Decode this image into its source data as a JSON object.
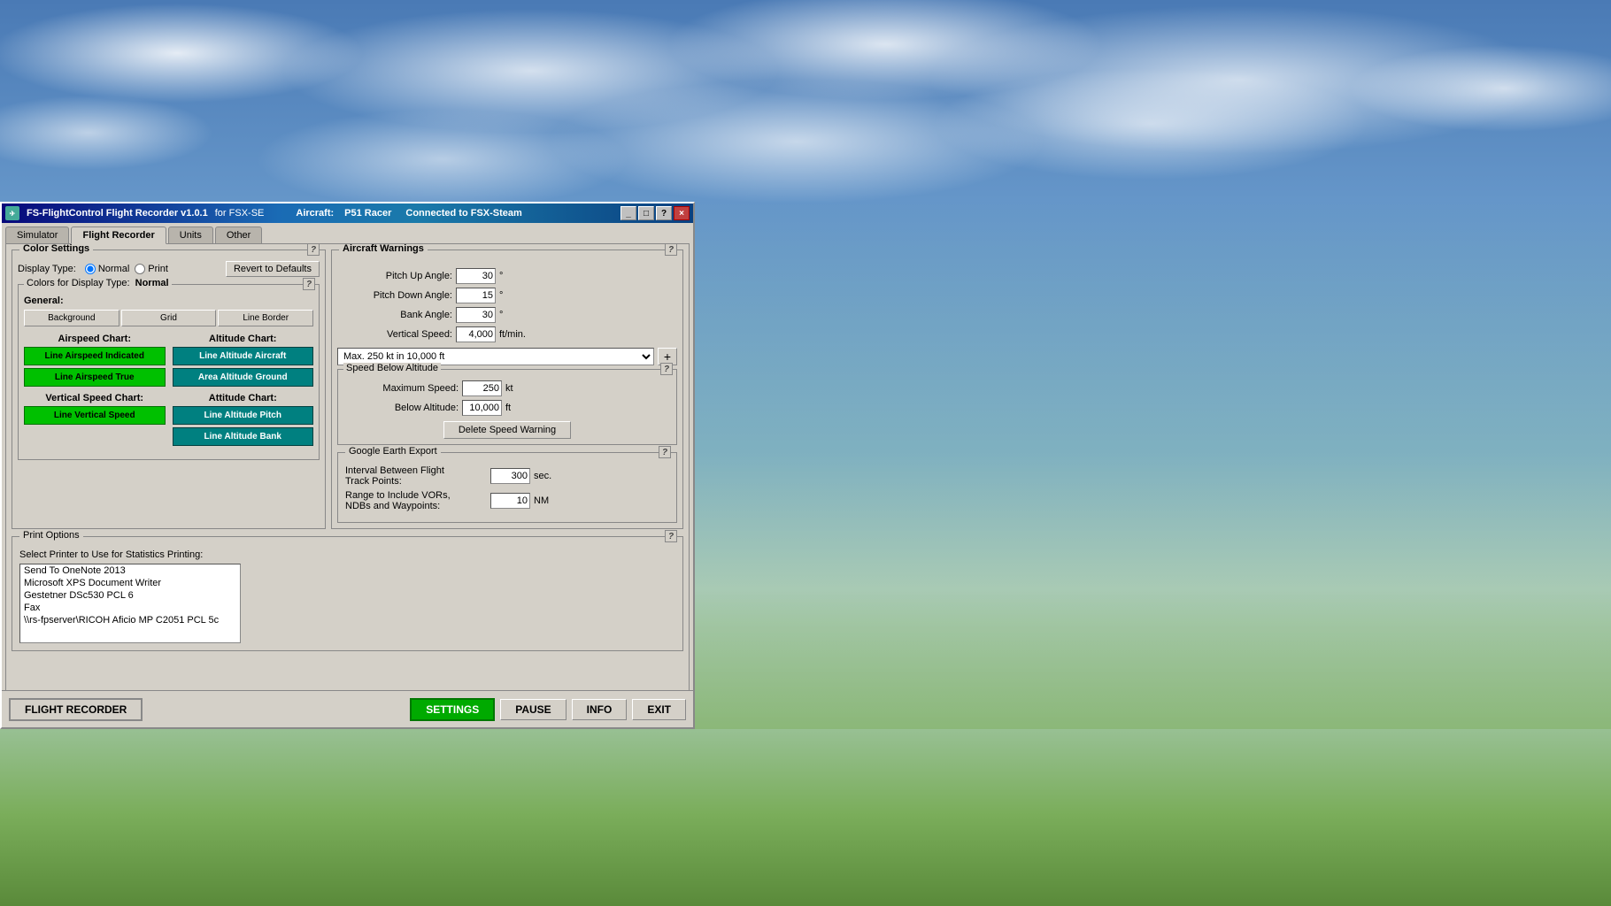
{
  "app": {
    "title_left": "FS-FlightControl Flight Recorder v1.0.1",
    "title_for": "for FSX-SE",
    "aircraft_label": "Aircraft:",
    "aircraft_name": "P51 Racer",
    "connection_status": "Connected to FSX-Steam"
  },
  "title_buttons": {
    "minimize": "_",
    "maximize": "□",
    "help": "?",
    "close": "×"
  },
  "tabs": [
    {
      "id": "simulator",
      "label": "Simulator"
    },
    {
      "id": "flight-recorder",
      "label": "Flight Recorder",
      "active": true
    },
    {
      "id": "units",
      "label": "Units"
    },
    {
      "id": "other",
      "label": "Other"
    }
  ],
  "color_settings": {
    "title": "Color Settings",
    "display_type_label": "Display Type:",
    "radio_normal": "Normal",
    "radio_print": "Print",
    "revert_btn": "Revert to Defaults",
    "colors_for_label": "Colors for Display Type:",
    "colors_for_value": "Normal",
    "help_icon": "?",
    "general_label": "General:",
    "btn_background": "Background",
    "btn_grid": "Grid",
    "btn_line_border": "Line Border",
    "airspeed_chart_label": "Airspeed Chart:",
    "altitude_chart_label": "Altitude Chart:",
    "btn_line_airspeed_indicated": "Line Airspeed Indicated",
    "btn_line_altitude_aircraft": "Line Altitude Aircraft",
    "btn_line_airspeed_true": "Line Airspeed True",
    "btn_area_altitude_ground": "Area Altitude Ground",
    "vertical_speed_label": "Vertical Speed Chart:",
    "attitude_chart_label": "Attitude Chart:",
    "btn_line_vertical_speed": "Line Vertical Speed",
    "btn_line_attitude_pitch": "Line Altitude Pitch",
    "btn_line_attitude_bank": "Line Altitude Bank"
  },
  "aircraft_warnings": {
    "title": "Aircraft Warnings",
    "help_icon": "?",
    "pitch_up_label": "Pitch Up Angle:",
    "pitch_up_value": "30",
    "pitch_up_unit": "°",
    "pitch_down_label": "Pitch Down Angle:",
    "pitch_down_value": "15",
    "pitch_down_unit": "°",
    "bank_angle_label": "Bank Angle:",
    "bank_angle_value": "30",
    "bank_angle_unit": "°",
    "vertical_speed_label": "Vertical Speed:",
    "vertical_speed_value": "4,000",
    "vertical_speed_unit": "ft/min.",
    "dropdown_value": "Max. 250 kt in 10,000 ft",
    "add_btn": "+",
    "speed_below_title": "Speed Below Altitude",
    "speed_below_help": "?",
    "max_speed_label": "Maximum Speed:",
    "max_speed_value": "250",
    "max_speed_unit": "kt",
    "below_alt_label": "Below Altitude:",
    "below_alt_value": "10,000",
    "below_alt_unit": "ft",
    "delete_btn": "Delete Speed Warning"
  },
  "google_earth": {
    "title": "Google Earth Export",
    "help_icon": "?",
    "interval_label": "Interval Between Flight",
    "track_points_label": "Track Points:",
    "interval_value": "300",
    "interval_unit": "sec.",
    "range_label": "Range to Include VORs,",
    "ndbs_label": "NDBs and Waypoints:",
    "range_value": "10",
    "range_unit": "NM"
  },
  "print_options": {
    "title": "Print Options",
    "help_icon": "?",
    "printer_label": "Select Printer to Use for Statistics Printing:",
    "printers": [
      "Send To OneNote 2013",
      "Microsoft XPS Document Writer",
      "Gestetner DSc530 PCL 6",
      "Fax",
      "\\\\rs-fpserver\\RICOH Aficio MP C2051 PCL 5c"
    ]
  },
  "bottom_toolbar": {
    "flight_recorder_btn": "FLIGHT RECORDER",
    "settings_btn": "SETTINGS",
    "pause_btn": "PAUSE",
    "info_btn": "INFO",
    "exit_btn": "EXIT"
  }
}
